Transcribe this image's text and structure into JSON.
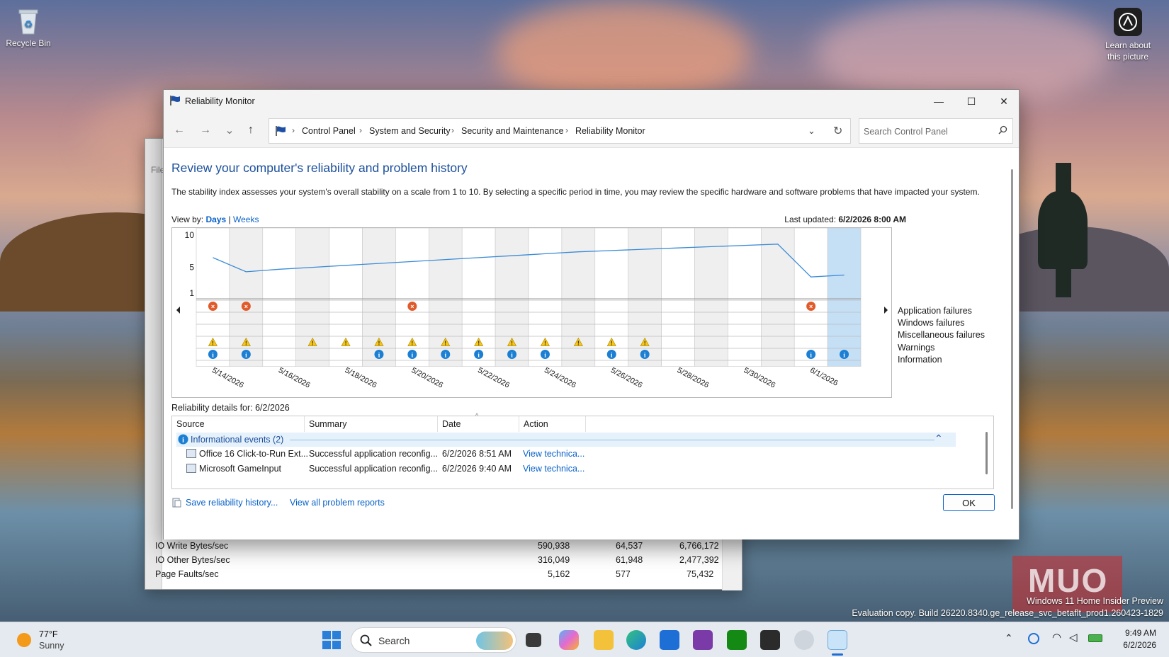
{
  "desktop": {
    "recycle_bin_label": "Recycle Bin",
    "spotlight_label": "Learn about this picture",
    "edition_text": "Windows 11 Home Insider Preview",
    "build_text": "Evaluation copy. Build 26220.8340.ge_release_svc_betaflt_prod1.260423-1829",
    "watermark_text": "MUO"
  },
  "background_window": {
    "menu_text": "File",
    "rows": [
      {
        "label": "IO Write Bytes/sec",
        "v1": "590,938",
        "v2": "64,537",
        "v3": "6,766,172"
      },
      {
        "label": "IO Other Bytes/sec",
        "v1": "316,049",
        "v2": "61,948",
        "v3": "2,477,392"
      },
      {
        "label": "Page Faults/sec",
        "v1": "5,162",
        "v2": "577",
        "v3": "75,432"
      }
    ]
  },
  "window": {
    "title": "Reliability Monitor",
    "minimize_glyph": "—",
    "maximize_glyph": "☐",
    "close_glyph": "✕"
  },
  "nav": {
    "back_glyph": "←",
    "forward_glyph": "→",
    "recent_glyph": "⌄",
    "up_glyph": "↑",
    "breadcrumb": [
      "Control Panel",
      "System and Security",
      "Security and Maintenance",
      "Reliability Monitor"
    ],
    "search_placeholder": "Search Control Panel"
  },
  "page": {
    "title": "Review your computer's reliability and problem history",
    "description": "The stability index assesses your system's overall stability on a scale from 1 to 10. By selecting a specific period in time, you may review the specific hardware and software problems that have impacted your system.",
    "view_by_label": "View by:",
    "view_days": "Days",
    "view_sep": "|",
    "view_weeks": "Weeks",
    "last_updated_label": "Last updated:",
    "last_updated_value": "6/2/2026 8:00 AM"
  },
  "chart_data": {
    "type": "line",
    "ylim": [
      1,
      10
    ],
    "yticks": [
      "10",
      "5",
      "1"
    ],
    "x_labels": [
      "5/14/2026",
      "5/16/2026",
      "5/18/2026",
      "5/20/2026",
      "5/22/2026",
      "5/24/2026",
      "5/26/2026",
      "5/28/2026",
      "5/30/2026",
      "6/1/2026"
    ],
    "columns": [
      "5/14/2026",
      "5/15/2026",
      "5/16/2026",
      "5/17/2026",
      "5/18/2026",
      "5/19/2026",
      "5/20/2026",
      "5/21/2026",
      "5/22/2026",
      "5/23/2026",
      "5/24/2026",
      "5/25/2026",
      "5/26/2026",
      "5/27/2026",
      "5/28/2026",
      "5/29/2026",
      "5/30/2026",
      "5/31/2026",
      "6/1/2026",
      "6/2/2026"
    ],
    "stability_index": [
      6.5,
      4.3,
      4.7,
      5.0,
      5.3,
      5.6,
      5.9,
      6.2,
      6.5,
      6.8,
      7.1,
      7.4,
      7.6,
      7.8,
      8.0,
      8.2,
      8.4,
      8.6,
      3.5,
      3.8
    ],
    "events": {
      "Application failures": [
        0,
        1,
        6,
        18
      ],
      "Windows failures": [],
      "Miscellaneous failures": [],
      "Warnings": [
        0,
        1,
        3,
        4,
        5,
        6,
        7,
        8,
        9,
        10,
        11,
        12,
        13
      ],
      "Information": [
        0,
        1,
        5,
        6,
        7,
        8,
        9,
        10,
        12,
        13,
        18,
        19
      ]
    },
    "legend": [
      "Application failures",
      "Windows failures",
      "Miscellaneous failures",
      "Warnings",
      "Information"
    ],
    "selected_column": "6/2/2026",
    "colors": {
      "line": "#3b8bd6",
      "selected": "#c5dff5",
      "failure": "#e05a2a",
      "warning": "#f5c518",
      "info": "#1b7fd4"
    }
  },
  "details": {
    "label": "Reliability details for: 6/2/2026",
    "columns": [
      "Source",
      "Summary",
      "Date",
      "Action"
    ],
    "group_label": "Informational events (2)",
    "rows": [
      {
        "source": "Office 16 Click-to-Run Ext...",
        "summary": "Successful application reconfig...",
        "date": "6/2/2026 8:51 AM",
        "action": "View technica..."
      },
      {
        "source": "Microsoft GameInput",
        "summary": "Successful application reconfig...",
        "date": "6/2/2026 9:40 AM",
        "action": "View technica..."
      }
    ]
  },
  "footer": {
    "save_link": "Save reliability history...",
    "view_all_link": "View all problem reports",
    "ok_label": "OK"
  },
  "taskbar": {
    "weather_temp": "77°F",
    "weather_condition": "Sunny",
    "search_label": "Search",
    "time": "9:49 AM",
    "date": "6/2/2026"
  }
}
